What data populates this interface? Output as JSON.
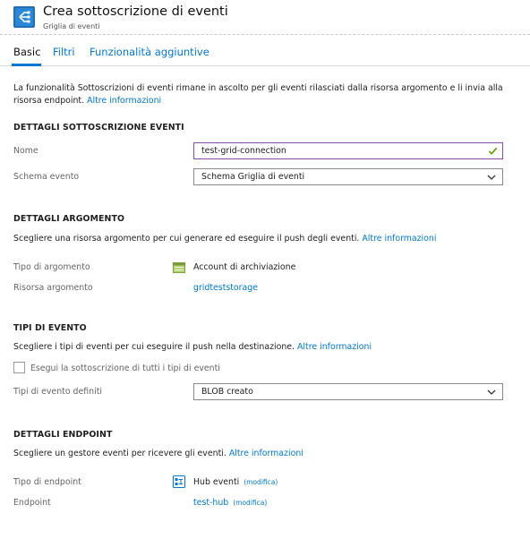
{
  "header": {
    "title": "Crea sottoscrizione di eventi",
    "subtitle": "Griglia di eventi",
    "icon": "event-grid-icon"
  },
  "tabs": [
    {
      "label": "Basic",
      "active": true
    },
    {
      "label": "Filtri",
      "active": false
    },
    {
      "label": "Funzionalità aggiuntive",
      "active": false
    }
  ],
  "intro": {
    "text": "La funzionalità Sottoscrizioni di eventi rimane in ascolto per gli eventi rilasciati dalla risorsa argomento e li invia alla risorsa endpoint. ",
    "link": "Altre informazioni"
  },
  "subscription_details": {
    "heading": "DETTAGLI SOTTOSCRIZIONE EVENTI",
    "name_label": "Nome",
    "name_value": "test-grid-connection",
    "schema_label": "Schema evento",
    "schema_value": "Schema Griglia di eventi"
  },
  "topic_details": {
    "heading": "DETTAGLI ARGOMENTO",
    "description": "Scegliere una risorsa argomento per cui generare ed eseguire il push degli eventi. ",
    "link": "Altre informazioni",
    "type_label": "Tipo di argomento",
    "type_value": "Account di archiviazione",
    "resource_label": "Risorsa argomento",
    "resource_value": "gridteststorage"
  },
  "event_types": {
    "heading": "TIPI DI EVENTO",
    "description": "Scegliere i tipi di eventi per cui eseguire il push nella destinazione. ",
    "link": "Altre informazioni",
    "all_types_label": "Esegui la sottoscrizione di tutti i tipi di eventi",
    "all_types_checked": false,
    "defined_label": "Tipi di evento definiti",
    "defined_value": "BLOB creato"
  },
  "endpoint_details": {
    "heading": "DETTAGLI ENDPOINT",
    "description": "Scegliere un gestore eventi per ricevere gli eventi. ",
    "link": "Altre informazioni",
    "type_label": "Tipo di endpoint",
    "type_value": "Hub eventi",
    "type_edit": "(modifica)",
    "endpoint_label": "Endpoint",
    "endpoint_value": "test-hub",
    "endpoint_edit": "(modifica)"
  },
  "colors": {
    "accent": "#0078d4",
    "input_focus_border": "#8a4ba8",
    "valid_check": "#57a300"
  }
}
